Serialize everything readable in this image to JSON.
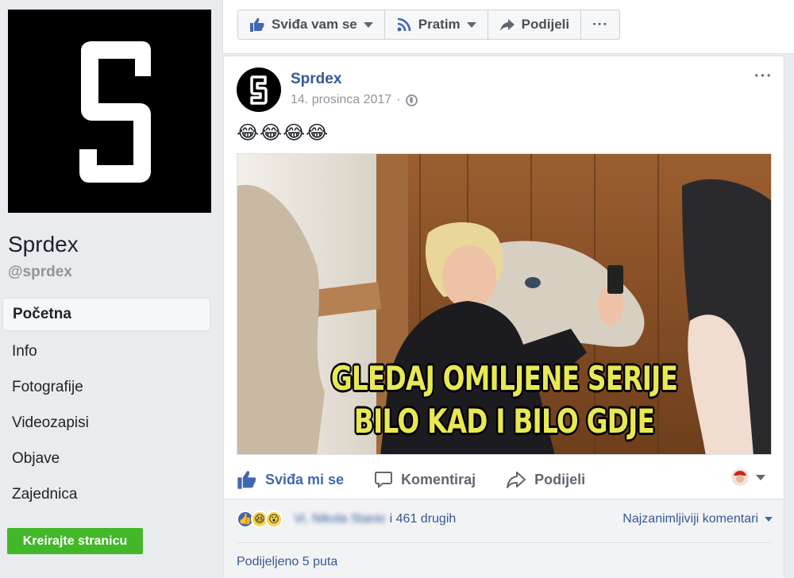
{
  "sidebar": {
    "page_name": "Sprdex",
    "handle": "@sprdex",
    "nav": [
      {
        "label": "Početna",
        "active": true
      },
      {
        "label": "Info"
      },
      {
        "label": "Fotografije"
      },
      {
        "label": "Videozapisi"
      },
      {
        "label": "Objave"
      },
      {
        "label": "Zajednica"
      }
    ],
    "create_page": "Kreirajte stranicu"
  },
  "actionbar": {
    "like": "Sviđa vam se",
    "follow": "Pratim",
    "share": "Podijeli",
    "more": "···"
  },
  "post": {
    "author": "Sprdex",
    "date": "14. prosinca 2017",
    "separator": "·",
    "text": "😂😂😂😂",
    "caption_line1": "GLEDAJ OMILJENE SERIJE",
    "caption_line2": "BILO KAD I BILO GDJE",
    "actions": {
      "like": "Sviđa mi se",
      "comment": "Komentiraj",
      "share": "Podijeli"
    },
    "reactions": {
      "names_blurred": "Vi, Nikola Stanic",
      "others": "i 461 drugih",
      "sort": "Najzanimljiviji komentari",
      "shares": "Podijeljeno 5 puta"
    }
  },
  "colors": {
    "brand_blue": "#4267b2",
    "link_blue": "#365899",
    "green": "#42b72a",
    "caption_yellow": "#e8e855"
  }
}
